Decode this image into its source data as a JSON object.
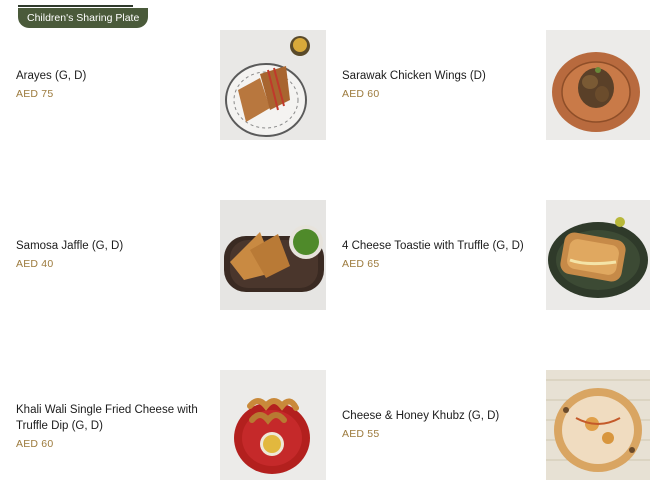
{
  "section": {
    "tab_label": "Children's Sharing Plate"
  },
  "items": [
    {
      "name": "Arayes (G, D)",
      "price": "AED 75",
      "image": "arayes-photo"
    },
    {
      "name": "Sarawak Chicken Wings (D)",
      "price": "AED 60",
      "image": "chicken-wings-photo"
    },
    {
      "name": "Samosa Jaffle (G, D)",
      "price": "AED 40",
      "image": "samosa-jaffle-photo"
    },
    {
      "name": "4 Cheese Toastie with Truffle (G, D)",
      "price": "AED 65",
      "image": "cheese-toastie-photo"
    },
    {
      "name": "Khali Wali Single Fried Cheese with Truffle Dip (G, D)",
      "price": "AED 60",
      "image": "fried-cheese-photo"
    },
    {
      "name": "Cheese & Honey Khubz (G, D)",
      "price": "AED 55",
      "image": "khubz-photo"
    }
  ],
  "colors": {
    "tab_bg": "#4a5a3a",
    "price": "#9c7a3c"
  }
}
